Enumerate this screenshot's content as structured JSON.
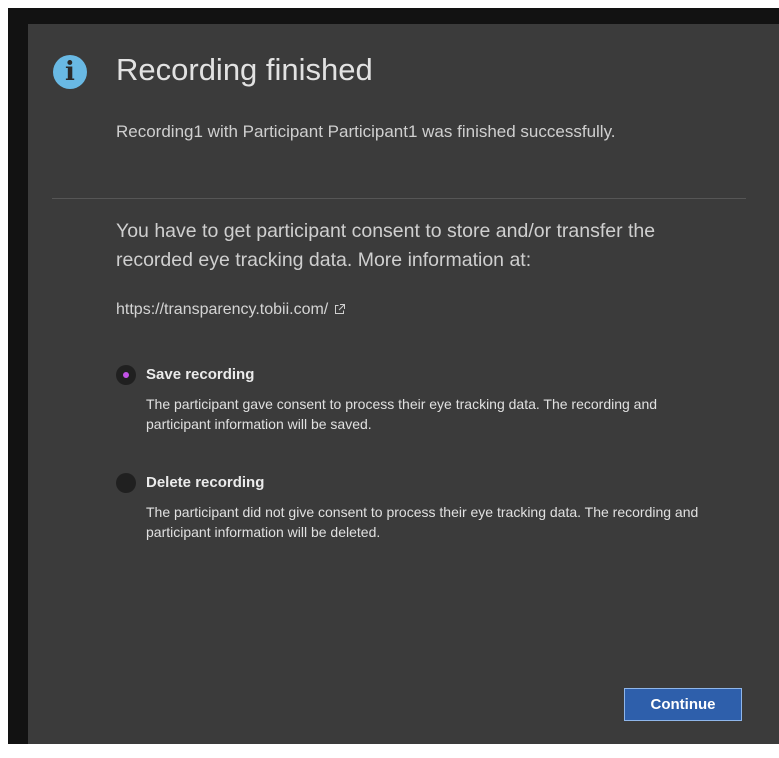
{
  "dialog": {
    "title": "Recording finished",
    "summary": "Recording1 with Participant Participant1 was finished successfully.",
    "consent_text": "You have to get participant consent to store and/or transfer the recorded eye tracking data. More information at:",
    "link_text": "https://transparency.tobii.com/",
    "options": [
      {
        "label": "Save recording",
        "description": "The participant gave consent to process their eye tracking data. The recording and participant information will be saved.",
        "selected": true
      },
      {
        "label": "Delete recording",
        "description": "The participant did not give consent to process their eye tracking data. The recording and participant information will be deleted.",
        "selected": false
      }
    ],
    "continue_label": "Continue"
  },
  "icons": {
    "info": "info-icon",
    "external_link": "external-link-icon"
  },
  "colors": {
    "dialog_background": "#3b3b3b",
    "backdrop": "#121212",
    "info_icon": "#69b9e4",
    "radio_selected_dot": "#c252e6",
    "primary_button": "#2e5fab",
    "primary_button_border": "#8fb6ea"
  }
}
